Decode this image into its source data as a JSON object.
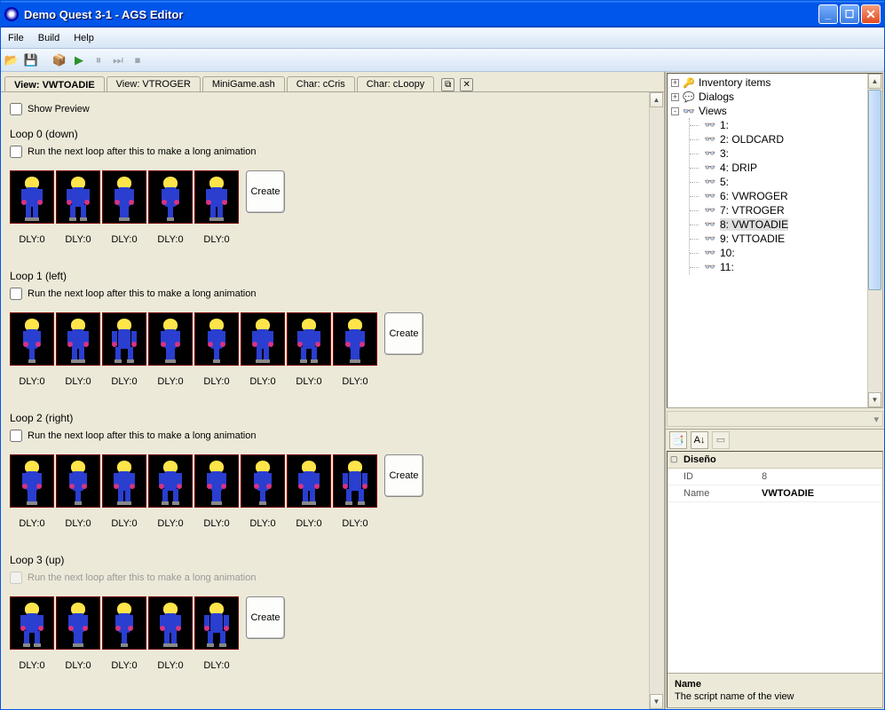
{
  "window": {
    "title": "Demo Quest 3-1 - AGS Editor"
  },
  "menu": {
    "file": "File",
    "build": "Build",
    "help": "Help"
  },
  "tabs": [
    {
      "label": "View: VWTOADIE",
      "active": true
    },
    {
      "label": "View: VTROGER",
      "active": false
    },
    {
      "label": "MiniGame.ash",
      "active": false
    },
    {
      "label": "Char: cCris",
      "active": false
    },
    {
      "label": "Char: cLoopy",
      "active": false
    }
  ],
  "show_preview_label": "Show Preview",
  "run_next_label": "Run the next loop after this to make a long animation",
  "create_label": "Create",
  "loops": [
    {
      "title": "Loop 0 (down)",
      "frames": 5,
      "disabled": false
    },
    {
      "title": "Loop 1 (left)",
      "frames": 8,
      "disabled": false
    },
    {
      "title": "Loop 2 (right)",
      "frames": 8,
      "disabled": false
    },
    {
      "title": "Loop 3 (up)",
      "frames": 5,
      "disabled": true
    }
  ],
  "dly_label": "DLY:0",
  "tree": {
    "inventory": "Inventory items",
    "dialogs": "Dialogs",
    "views": "Views",
    "items": [
      "1:",
      "2: OLDCARD",
      "3:",
      "4: DRIP",
      "5:",
      "6: VWROGER",
      "7: VTROGER",
      "8: VWTOADIE",
      "9: VTTOADIE",
      "10:",
      "11:"
    ],
    "selected_index": 7
  },
  "properties": {
    "section": "Diseño",
    "rows": [
      {
        "key": "ID",
        "value": "8",
        "bold": false
      },
      {
        "key": "Name",
        "value": "VWTOADIE",
        "bold": true
      }
    ],
    "desc_title": "Name",
    "desc_text": "The script name of the view"
  }
}
